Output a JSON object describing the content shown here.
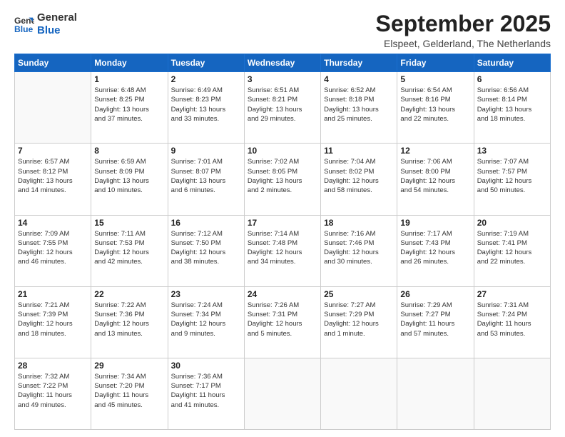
{
  "header": {
    "logo_line1": "General",
    "logo_line2": "Blue",
    "month": "September 2025",
    "location": "Elspeet, Gelderland, The Netherlands"
  },
  "weekdays": [
    "Sunday",
    "Monday",
    "Tuesday",
    "Wednesday",
    "Thursday",
    "Friday",
    "Saturday"
  ],
  "weeks": [
    [
      {
        "day": "",
        "info": ""
      },
      {
        "day": "1",
        "info": "Sunrise: 6:48 AM\nSunset: 8:25 PM\nDaylight: 13 hours\nand 37 minutes."
      },
      {
        "day": "2",
        "info": "Sunrise: 6:49 AM\nSunset: 8:23 PM\nDaylight: 13 hours\nand 33 minutes."
      },
      {
        "day": "3",
        "info": "Sunrise: 6:51 AM\nSunset: 8:21 PM\nDaylight: 13 hours\nand 29 minutes."
      },
      {
        "day": "4",
        "info": "Sunrise: 6:52 AM\nSunset: 8:18 PM\nDaylight: 13 hours\nand 25 minutes."
      },
      {
        "day": "5",
        "info": "Sunrise: 6:54 AM\nSunset: 8:16 PM\nDaylight: 13 hours\nand 22 minutes."
      },
      {
        "day": "6",
        "info": "Sunrise: 6:56 AM\nSunset: 8:14 PM\nDaylight: 13 hours\nand 18 minutes."
      }
    ],
    [
      {
        "day": "7",
        "info": "Sunrise: 6:57 AM\nSunset: 8:12 PM\nDaylight: 13 hours\nand 14 minutes."
      },
      {
        "day": "8",
        "info": "Sunrise: 6:59 AM\nSunset: 8:09 PM\nDaylight: 13 hours\nand 10 minutes."
      },
      {
        "day": "9",
        "info": "Sunrise: 7:01 AM\nSunset: 8:07 PM\nDaylight: 13 hours\nand 6 minutes."
      },
      {
        "day": "10",
        "info": "Sunrise: 7:02 AM\nSunset: 8:05 PM\nDaylight: 13 hours\nand 2 minutes."
      },
      {
        "day": "11",
        "info": "Sunrise: 7:04 AM\nSunset: 8:02 PM\nDaylight: 12 hours\nand 58 minutes."
      },
      {
        "day": "12",
        "info": "Sunrise: 7:06 AM\nSunset: 8:00 PM\nDaylight: 12 hours\nand 54 minutes."
      },
      {
        "day": "13",
        "info": "Sunrise: 7:07 AM\nSunset: 7:57 PM\nDaylight: 12 hours\nand 50 minutes."
      }
    ],
    [
      {
        "day": "14",
        "info": "Sunrise: 7:09 AM\nSunset: 7:55 PM\nDaylight: 12 hours\nand 46 minutes."
      },
      {
        "day": "15",
        "info": "Sunrise: 7:11 AM\nSunset: 7:53 PM\nDaylight: 12 hours\nand 42 minutes."
      },
      {
        "day": "16",
        "info": "Sunrise: 7:12 AM\nSunset: 7:50 PM\nDaylight: 12 hours\nand 38 minutes."
      },
      {
        "day": "17",
        "info": "Sunrise: 7:14 AM\nSunset: 7:48 PM\nDaylight: 12 hours\nand 34 minutes."
      },
      {
        "day": "18",
        "info": "Sunrise: 7:16 AM\nSunset: 7:46 PM\nDaylight: 12 hours\nand 30 minutes."
      },
      {
        "day": "19",
        "info": "Sunrise: 7:17 AM\nSunset: 7:43 PM\nDaylight: 12 hours\nand 26 minutes."
      },
      {
        "day": "20",
        "info": "Sunrise: 7:19 AM\nSunset: 7:41 PM\nDaylight: 12 hours\nand 22 minutes."
      }
    ],
    [
      {
        "day": "21",
        "info": "Sunrise: 7:21 AM\nSunset: 7:39 PM\nDaylight: 12 hours\nand 18 minutes."
      },
      {
        "day": "22",
        "info": "Sunrise: 7:22 AM\nSunset: 7:36 PM\nDaylight: 12 hours\nand 13 minutes."
      },
      {
        "day": "23",
        "info": "Sunrise: 7:24 AM\nSunset: 7:34 PM\nDaylight: 12 hours\nand 9 minutes."
      },
      {
        "day": "24",
        "info": "Sunrise: 7:26 AM\nSunset: 7:31 PM\nDaylight: 12 hours\nand 5 minutes."
      },
      {
        "day": "25",
        "info": "Sunrise: 7:27 AM\nSunset: 7:29 PM\nDaylight: 12 hours\nand 1 minute."
      },
      {
        "day": "26",
        "info": "Sunrise: 7:29 AM\nSunset: 7:27 PM\nDaylight: 11 hours\nand 57 minutes."
      },
      {
        "day": "27",
        "info": "Sunrise: 7:31 AM\nSunset: 7:24 PM\nDaylight: 11 hours\nand 53 minutes."
      }
    ],
    [
      {
        "day": "28",
        "info": "Sunrise: 7:32 AM\nSunset: 7:22 PM\nDaylight: 11 hours\nand 49 minutes."
      },
      {
        "day": "29",
        "info": "Sunrise: 7:34 AM\nSunset: 7:20 PM\nDaylight: 11 hours\nand 45 minutes."
      },
      {
        "day": "30",
        "info": "Sunrise: 7:36 AM\nSunset: 7:17 PM\nDaylight: 11 hours\nand 41 minutes."
      },
      {
        "day": "",
        "info": ""
      },
      {
        "day": "",
        "info": ""
      },
      {
        "day": "",
        "info": ""
      },
      {
        "day": "",
        "info": ""
      }
    ]
  ]
}
